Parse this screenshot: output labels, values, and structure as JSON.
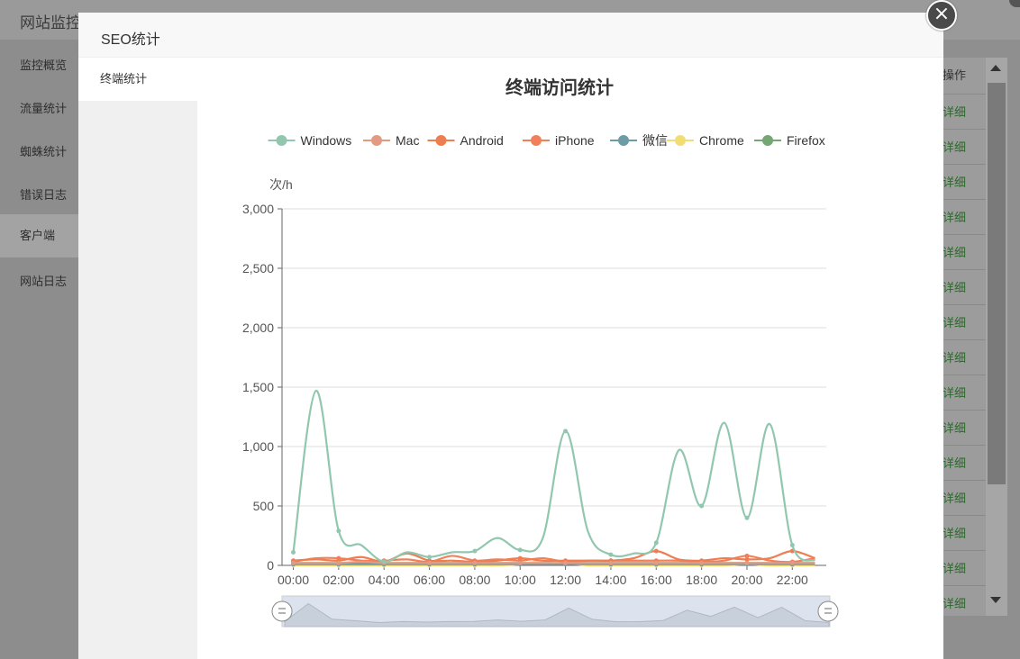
{
  "background": {
    "title": "网站监控",
    "sidebar": [
      {
        "label": "监控概览",
        "active": false
      },
      {
        "label": "流量统计",
        "active": false
      },
      {
        "label": "蜘蛛统计",
        "active": false
      },
      {
        "label": "错误日志",
        "active": false
      },
      {
        "label": "客户端",
        "active": true
      },
      {
        "label": "网站日志",
        "active": false
      }
    ],
    "table_header": "操作",
    "row_link": "详细",
    "row_count": 15
  },
  "modal": {
    "title": "SEO统计",
    "nav": [
      {
        "label": "终端统计"
      }
    ],
    "close_icon": "close-icon"
  },
  "chart_data": {
    "type": "line",
    "title": "终端访问统计",
    "ylabel": "次/h",
    "ylim": [
      0,
      3000
    ],
    "yticks": [
      "0",
      "500",
      "1,000",
      "1,500",
      "2,000",
      "2,500",
      "3,000"
    ],
    "xtick_labels": [
      "00:00",
      "02:00",
      "04:00",
      "06:00",
      "08:00",
      "10:00",
      "12:00",
      "14:00",
      "16:00",
      "18:00",
      "20:00",
      "22:00"
    ],
    "legend_position": "top",
    "smooth": true,
    "x": [
      "00:00",
      "01:00",
      "02:00",
      "03:00",
      "04:00",
      "05:00",
      "06:00",
      "07:00",
      "08:00",
      "09:00",
      "10:00",
      "11:00",
      "12:00",
      "13:00",
      "14:00",
      "15:00",
      "16:00",
      "17:00",
      "18:00",
      "19:00",
      "20:00",
      "21:00",
      "22:00",
      "23:00"
    ],
    "series": [
      {
        "name": "Windows",
        "color": "#91c7ae",
        "values": [
          110,
          1470,
          290,
          170,
          30,
          110,
          70,
          110,
          120,
          230,
          130,
          230,
          1130,
          280,
          90,
          100,
          190,
          970,
          500,
          1200,
          400,
          1190,
          170,
          40
        ]
      },
      {
        "name": "Mac",
        "color": "#e49a82",
        "values": [
          20,
          20,
          20,
          30,
          20,
          20,
          20,
          20,
          20,
          20,
          20,
          20,
          20,
          20,
          20,
          20,
          20,
          20,
          20,
          20,
          20,
          20,
          20,
          20
        ]
      },
      {
        "name": "Android",
        "color": "#ee7d51",
        "values": [
          40,
          50,
          40,
          70,
          30,
          100,
          40,
          40,
          30,
          40,
          60,
          40,
          40,
          40,
          40,
          60,
          120,
          50,
          40,
          60,
          50,
          60,
          120,
          60
        ]
      },
      {
        "name": "iPhone",
        "color": "#f0805a",
        "values": [
          30,
          60,
          60,
          40,
          40,
          50,
          30,
          80,
          40,
          50,
          40,
          60,
          30,
          40,
          40,
          40,
          40,
          40,
          30,
          40,
          80,
          40,
          30,
          60
        ]
      },
      {
        "name": "微信",
        "color": "#6e9ca5",
        "values": [
          10,
          10,
          10,
          10,
          10,
          10,
          10,
          10,
          10,
          10,
          10,
          10,
          10,
          10,
          10,
          10,
          10,
          10,
          10,
          10,
          10,
          10,
          10,
          10
        ]
      },
      {
        "name": "Chrome",
        "color": "#f2dc74",
        "values": [
          0,
          0,
          0,
          0,
          0,
          0,
          0,
          0,
          0,
          0,
          10,
          40,
          20,
          0,
          0,
          0,
          0,
          0,
          0,
          0,
          10,
          0,
          0,
          0
        ]
      },
      {
        "name": "Firefox",
        "color": "#75a774",
        "values": [
          20,
          20,
          20,
          20,
          20,
          20,
          20,
          20,
          20,
          20,
          20,
          20,
          20,
          20,
          20,
          20,
          20,
          20,
          20,
          20,
          20,
          20,
          20,
          20
        ]
      }
    ]
  }
}
